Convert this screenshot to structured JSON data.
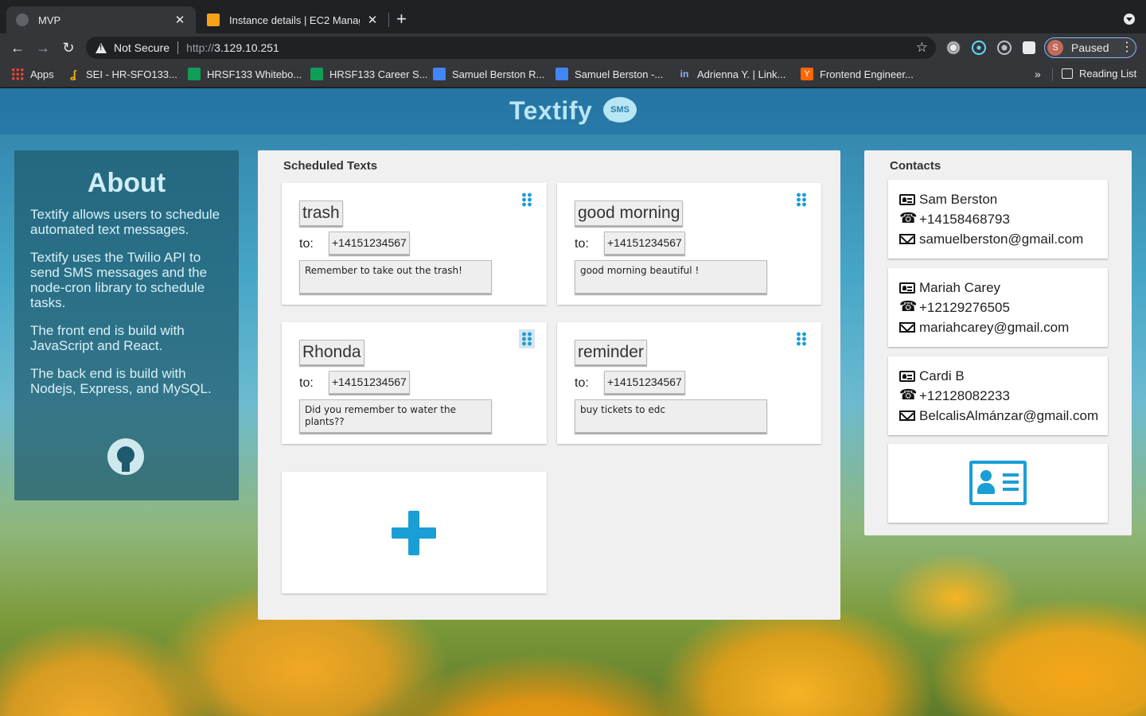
{
  "browser": {
    "tabs": [
      {
        "title": "MVP",
        "active": true
      },
      {
        "title": "Instance details | EC2 Manager",
        "active": false
      }
    ],
    "address": {
      "security_label": "Not Secure",
      "scheme": "http://",
      "host": "3.129.10.251"
    },
    "profile": {
      "initial": "S",
      "status": "Paused"
    },
    "bookmarks": [
      {
        "label": "Apps",
        "icon": "apps-grid-icon"
      },
      {
        "label": "SEI - HR-SFO133...",
        "icon": "sei-icon"
      },
      {
        "label": "HRSF133 Whitebo...",
        "icon": "sheets-icon"
      },
      {
        "label": "HRSF133 Career S...",
        "icon": "sheets-icon"
      },
      {
        "label": "Samuel Berston R...",
        "icon": "docs-icon"
      },
      {
        "label": "Samuel Berston -...",
        "icon": "docs-icon"
      },
      {
        "label": "Adrienna Y. | Link...",
        "icon": "linkedin-icon"
      },
      {
        "label": "Frontend Engineer...",
        "icon": "ycombinator-icon"
      }
    ],
    "overflow_label": "»",
    "reading_list_label": "Reading List"
  },
  "app": {
    "title": "Textify",
    "logo_badge": "SMS",
    "colors": {
      "accent": "#1a9ed6",
      "panel": "#f0f0f0"
    }
  },
  "about": {
    "heading": "About",
    "paragraphs": [
      "Textify allows users to schedule automated text messages.",
      "Textify uses the Twilio API to send SMS messages and the node-cron library to schedule tasks.",
      "The front end is build with JavaScript and React.",
      "The back end is build with Nodejs, Express, and MySQL."
    ],
    "link_icon": "github-icon"
  },
  "scheduled": {
    "heading": "Scheduled Texts",
    "to_label": "to:",
    "texts": [
      {
        "title": "trash",
        "phone": "+14151234567",
        "message": "Remember to take out the trash!"
      },
      {
        "title": "good morning",
        "phone": "+14151234567",
        "message": "good morning beautiful !"
      },
      {
        "title": "Rhonda",
        "phone": "+14151234567",
        "message": "Did you remember to water the plants??"
      },
      {
        "title": "reminder",
        "phone": "+14151234567",
        "message": "buy tickets to edc"
      }
    ],
    "add_icon": "plus-icon"
  },
  "contacts": {
    "heading": "Contacts",
    "list": [
      {
        "name": "Sam Berston",
        "phone": "+14158468793",
        "email": "samuelberston@gmail.com"
      },
      {
        "name": "Mariah Carey",
        "phone": "+12129276505",
        "email": "mariahcarey@gmail.com"
      },
      {
        "name": "Cardi B",
        "phone": "+12128082233",
        "email": "BelcalisAlmánzar@gmail.com"
      }
    ],
    "add_icon": "address-card-icon"
  }
}
